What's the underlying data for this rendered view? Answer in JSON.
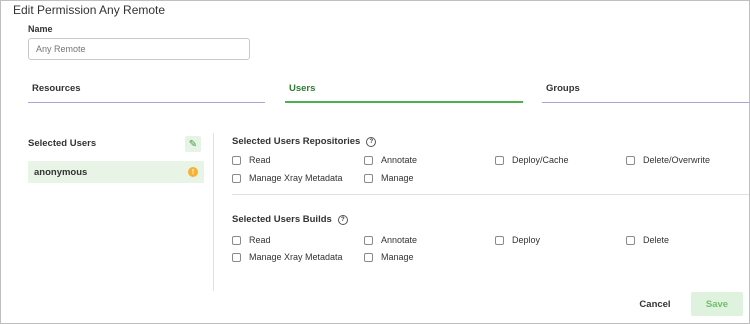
{
  "dialog": {
    "title": "Edit Permission Any Remote"
  },
  "name_field": {
    "label": "Name",
    "placeholder": "Any Remote"
  },
  "tabs": [
    {
      "label": "Resources",
      "active": false
    },
    {
      "label": "Users",
      "active": true
    },
    {
      "label": "Groups",
      "active": false
    }
  ],
  "selected_users": {
    "title": "Selected Users",
    "edit_icon": "pencil-icon",
    "users": [
      {
        "name": "anonymous",
        "status_icon": "warning-icon"
      }
    ]
  },
  "repositories": {
    "title": "Selected Users Repositories",
    "help_icon": "help-icon",
    "permissions": [
      {
        "label": "Read",
        "checked": false
      },
      {
        "label": "Annotate",
        "checked": false
      },
      {
        "label": "Deploy/Cache",
        "checked": false
      },
      {
        "label": "Delete/Overwrite",
        "checked": false
      },
      {
        "label": "Manage Xray Metadata",
        "checked": false
      },
      {
        "label": "Manage",
        "checked": false
      }
    ]
  },
  "builds": {
    "title": "Selected Users Builds",
    "help_icon": "help-icon",
    "permissions": [
      {
        "label": "Read",
        "checked": false
      },
      {
        "label": "Annotate",
        "checked": false
      },
      {
        "label": "Deploy",
        "checked": false
      },
      {
        "label": "Delete",
        "checked": false
      },
      {
        "label": "Manage Xray Metadata",
        "checked": false
      },
      {
        "label": "Manage",
        "checked": false
      }
    ]
  },
  "footer": {
    "cancel_label": "Cancel",
    "save_label": "Save"
  },
  "colors": {
    "accent_green": "#4caf50",
    "tab_underline": "#a9a4d6",
    "selected_row_bg": "#e8f5e6",
    "save_bg": "#dff2dd",
    "warning": "#f5b335"
  }
}
